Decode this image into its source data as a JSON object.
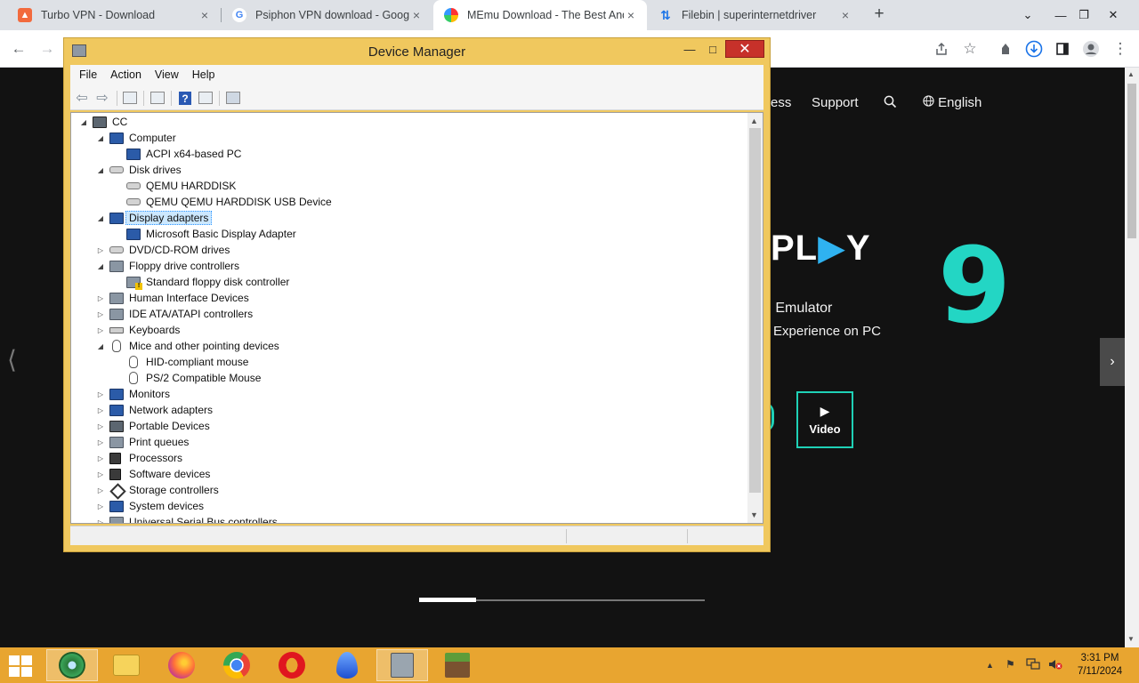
{
  "browser": {
    "tabs": [
      {
        "title": "Turbo VPN - Download",
        "favicon": "turbo-vpn-icon",
        "active": false
      },
      {
        "title": "Psiphon VPN download - Googl",
        "favicon": "google-icon",
        "active": false
      },
      {
        "title": "MEmu Download - The Best And",
        "favicon": "memu-icon",
        "active": true
      },
      {
        "title": "Filebin | superinternetdriver",
        "favicon": "filebin-icon",
        "active": false
      }
    ],
    "tab_close": "×",
    "new_tab": "+",
    "window_controls": {
      "dropdown": "⌄",
      "minimize": "—",
      "restore": "❐",
      "close": "✕"
    },
    "nav": {
      "back": "←",
      "forward": "→"
    }
  },
  "page": {
    "nav_links": {
      "partial": "ess",
      "support": "Support",
      "language": "English"
    },
    "brand_text": "PL",
    "brand_tri": "▶",
    "brand_tail": "Y",
    "brand_number": "9",
    "tagline1": "d Emulator",
    "tagline2": "Experience on PC",
    "video_label": "Video",
    "slider_progress": 0.2
  },
  "device_manager": {
    "title": "Device Manager",
    "menu": [
      "File",
      "Action",
      "View",
      "Help"
    ],
    "help_glyph": "?",
    "root": "CC",
    "tree": [
      {
        "label": "Computer",
        "level": 1,
        "expanded": true,
        "icon": "monitor"
      },
      {
        "label": "ACPI x64-based PC",
        "level": 2,
        "icon": "monitor"
      },
      {
        "label": "Disk drives",
        "level": 1,
        "expanded": true,
        "icon": "drive"
      },
      {
        "label": "QEMU HARDDISK",
        "level": 2,
        "icon": "drive"
      },
      {
        "label": "QEMU QEMU HARDDISK USB Device",
        "level": 2,
        "icon": "drive"
      },
      {
        "label": "Display adapters",
        "level": 1,
        "expanded": true,
        "icon": "monitor",
        "selected": true
      },
      {
        "label": "Microsoft Basic Display Adapter",
        "level": 2,
        "icon": "monitor"
      },
      {
        "label": "DVD/CD-ROM drives",
        "level": 1,
        "expanded": false,
        "icon": "drive"
      },
      {
        "label": "Floppy drive controllers",
        "level": 1,
        "expanded": true,
        "icon": "gray"
      },
      {
        "label": "Standard floppy disk controller",
        "level": 2,
        "icon": "warn"
      },
      {
        "label": "Human Interface Devices",
        "level": 1,
        "expanded": false,
        "icon": "gray"
      },
      {
        "label": "IDE ATA/ATAPI controllers",
        "level": 1,
        "expanded": false,
        "icon": "gray"
      },
      {
        "label": "Keyboards",
        "level": 1,
        "expanded": false,
        "icon": "keyboard"
      },
      {
        "label": "Mice and other pointing devices",
        "level": 1,
        "expanded": true,
        "icon": "mouse"
      },
      {
        "label": "HID-compliant mouse",
        "level": 2,
        "icon": "mouse"
      },
      {
        "label": "PS/2 Compatible Mouse",
        "level": 2,
        "icon": "mouse"
      },
      {
        "label": "Monitors",
        "level": 1,
        "expanded": false,
        "icon": "monitor"
      },
      {
        "label": "Network adapters",
        "level": 1,
        "expanded": false,
        "icon": "monitor"
      },
      {
        "label": "Portable Devices",
        "level": 1,
        "expanded": false,
        "icon": "pc"
      },
      {
        "label": "Print queues",
        "level": 1,
        "expanded": false,
        "icon": "gray"
      },
      {
        "label": "Processors",
        "level": 1,
        "expanded": false,
        "icon": "chip"
      },
      {
        "label": "Software devices",
        "level": 1,
        "expanded": false,
        "icon": "chip"
      },
      {
        "label": "Storage controllers",
        "level": 1,
        "expanded": false,
        "icon": "diamond"
      },
      {
        "label": "System devices",
        "level": 1,
        "expanded": false,
        "icon": "monitor"
      },
      {
        "label": "Universal Serial Bus controllers",
        "level": 1,
        "expanded": false,
        "icon": "gray"
      }
    ]
  },
  "taskbar": {
    "apps": [
      "network-app-icon",
      "file-explorer-icon",
      "firefox-icon",
      "chrome-icon",
      "opera-icon",
      "drop-app-icon",
      "device-manager-icon",
      "minecraft-icon"
    ],
    "tray_chevron": "▲",
    "time": "3:31 PM",
    "date": "7/11/2024"
  },
  "colors": {
    "taskbar": "#e8a530",
    "window_frame": "#f0c85e",
    "accent_teal": "#23d6c4"
  }
}
